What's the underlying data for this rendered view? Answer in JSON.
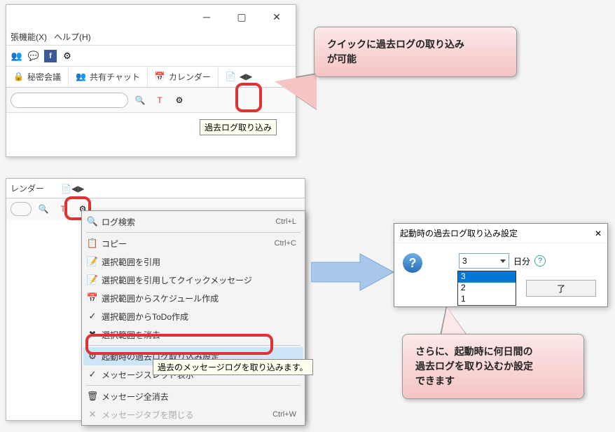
{
  "panel1": {
    "menu": {
      "extension": "張機能(X)",
      "help": "ヘルプ(H)"
    },
    "tabs": {
      "secret": "秘密会議",
      "shared_chat": "共有チャット",
      "calendar": "カレンダー"
    },
    "tooltip": "過去ログ取り込み"
  },
  "callout1": {
    "line1": "クイックに過去ログの取り込み",
    "line2": "が可能"
  },
  "panel2": {
    "tab_calendar": "レンダー"
  },
  "contextmenu": {
    "items": [
      {
        "label": "ログ検索",
        "shortcut": "Ctrl+L"
      },
      {
        "label": "コピー",
        "shortcut": "Ctrl+C"
      },
      {
        "label": "選択範囲を引用",
        "shortcut": ""
      },
      {
        "label": "選択範囲を引用してクイックメッセージ",
        "shortcut": ""
      },
      {
        "label": "選択範囲からスケジュール作成",
        "shortcut": ""
      },
      {
        "label": "選択範囲からToDo作成",
        "shortcut": ""
      },
      {
        "label": "選択範囲を消去",
        "shortcut": ""
      },
      {
        "label": "起動時の過去ログ取り込み設定",
        "shortcut": ""
      },
      {
        "label": "メッセージスレッド表示",
        "shortcut": ""
      },
      {
        "label": "メッセージ全消去",
        "shortcut": ""
      },
      {
        "label": "メッセージタブを閉じる",
        "shortcut": "Ctrl+W"
      }
    ],
    "tooltip": "過去のメッセージログを取り込みます。"
  },
  "dialog": {
    "title": "起動時の過去ログ取り込み設定",
    "selected": "3",
    "options": [
      "3",
      "2",
      "1"
    ],
    "suffix": "日分",
    "button_partial": "了"
  },
  "callout2": {
    "line1": "さらに、起動時に何日間の",
    "line2": "過去ログを取り込むか設定",
    "line3": "できます"
  }
}
